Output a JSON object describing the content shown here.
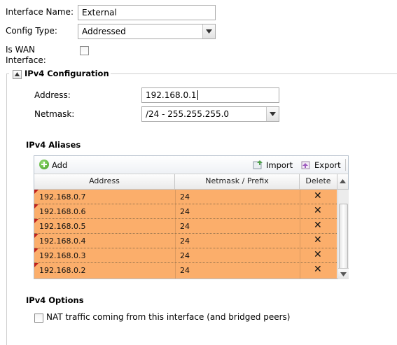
{
  "form": {
    "interface_name_label": "Interface Name:",
    "interface_name_value": "External",
    "config_type_label": "Config Type:",
    "config_type_value": "Addressed",
    "is_wan_label_line1": "Is WAN",
    "is_wan_label_line2": "Interface:",
    "is_wan_checked": false
  },
  "ipv4": {
    "section_title": "IPv4 Configuration",
    "address_label": "Address:",
    "address_value": "192.168.0.1",
    "netmask_label": "Netmask:",
    "netmask_value": "/24 - 255.255.255.0",
    "aliases_title": "IPv4 Aliases",
    "toolbar": {
      "add_label": "Add",
      "import_label": "Import",
      "export_label": "Export"
    },
    "columns": [
      "Address",
      "Netmask / Prefix",
      "Delete"
    ],
    "rows": [
      {
        "address": "192.168.0.7",
        "prefix": "24",
        "delete": "✕"
      },
      {
        "address": "192.168.0.6",
        "prefix": "24",
        "delete": "✕"
      },
      {
        "address": "192.168.0.5",
        "prefix": "24",
        "delete": "✕"
      },
      {
        "address": "192.168.0.4",
        "prefix": "24",
        "delete": "✕"
      },
      {
        "address": "192.168.0.3",
        "prefix": "24",
        "delete": "✕"
      },
      {
        "address": "192.168.0.2",
        "prefix": "24",
        "delete": "✕"
      }
    ],
    "row_color": "#fbae6b",
    "options_title": "IPv4 Options",
    "nat_label": "NAT traffic coming from this interface (and bridged peers)",
    "nat_checked": false
  }
}
